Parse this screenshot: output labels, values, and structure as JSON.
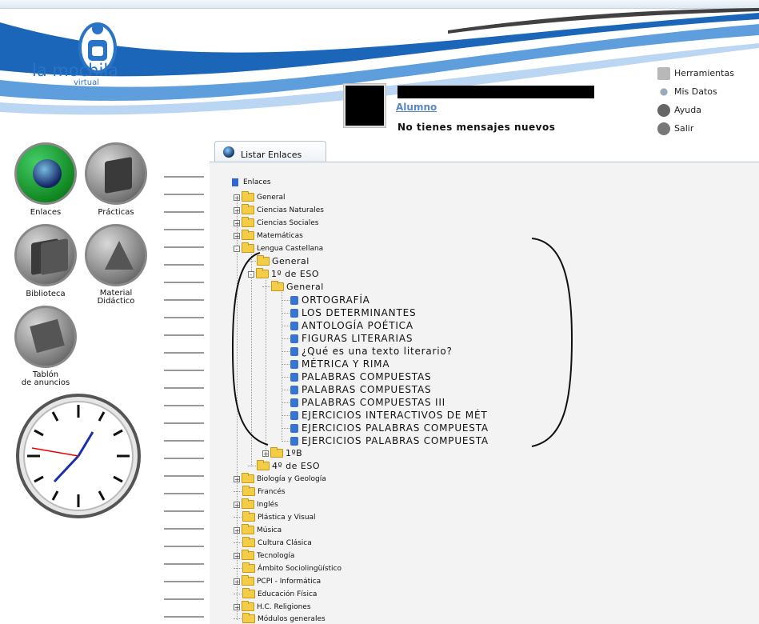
{
  "app": {
    "logo_text": "la mochila",
    "logo_sub": "virtual"
  },
  "user": {
    "role": "Alumno",
    "messages": "No tienes mensajes nuevos"
  },
  "topmenu": [
    {
      "label": "Herramientas",
      "icon": "tools-icon"
    },
    {
      "label": "Mis Datos",
      "icon": "user-icon"
    },
    {
      "label": "Ayuda",
      "icon": "help-icon"
    },
    {
      "label": "Salir",
      "icon": "exit-icon"
    }
  ],
  "leftnav": {
    "enlaces": "Enlaces",
    "practicas": "Prácticas",
    "biblioteca": "Biblioteca",
    "material_1": "Material",
    "material_2": "Didáctico",
    "tablon_1": "Tablón",
    "tablon_2": "de anuncios"
  },
  "tab": {
    "label": "Listar Enlaces"
  },
  "tree": {
    "root": "Enlaces",
    "top_items": [
      "General",
      "Ciencias Naturales",
      "Ciencias Sociales",
      "Matemáticas",
      "Lengua Castellana"
    ],
    "lengua_children": {
      "general": "General",
      "eso1": "1º de ESO",
      "eso1_general": "General",
      "links": [
        "ORTOGRAFÍA",
        "LOS DETERMINANTES",
        "ANTOLOGÍA POÉTICA",
        "FIGURAS LITERARIAS",
        "¿Qué es una texto literario?",
        "MÉTRICA Y RIMA",
        "PALABRAS COMPUESTAS",
        "PALABRAS COMPUESTAS",
        "PALABRAS COMPUESTAS III",
        "EJERCICIOS INTERACTIVOS DE MÉT",
        "EJERCICIOS PALABRAS COMPUESTA",
        "EJERCICIOS PALABRAS COMPUESTA"
      ],
      "b1": "1ºB",
      "eso4": "4º de ESO"
    },
    "bottom_items": [
      "Biología y Geología",
      "Francés",
      "Inglés",
      "Plástica y Visual",
      "Música",
      "Cultura Clásica",
      "Tecnología",
      "Ámbito Sociolingüístico",
      "PCPI - Informática",
      "Educación Física",
      "H.C. Religiones",
      "Módulos generales"
    ]
  }
}
